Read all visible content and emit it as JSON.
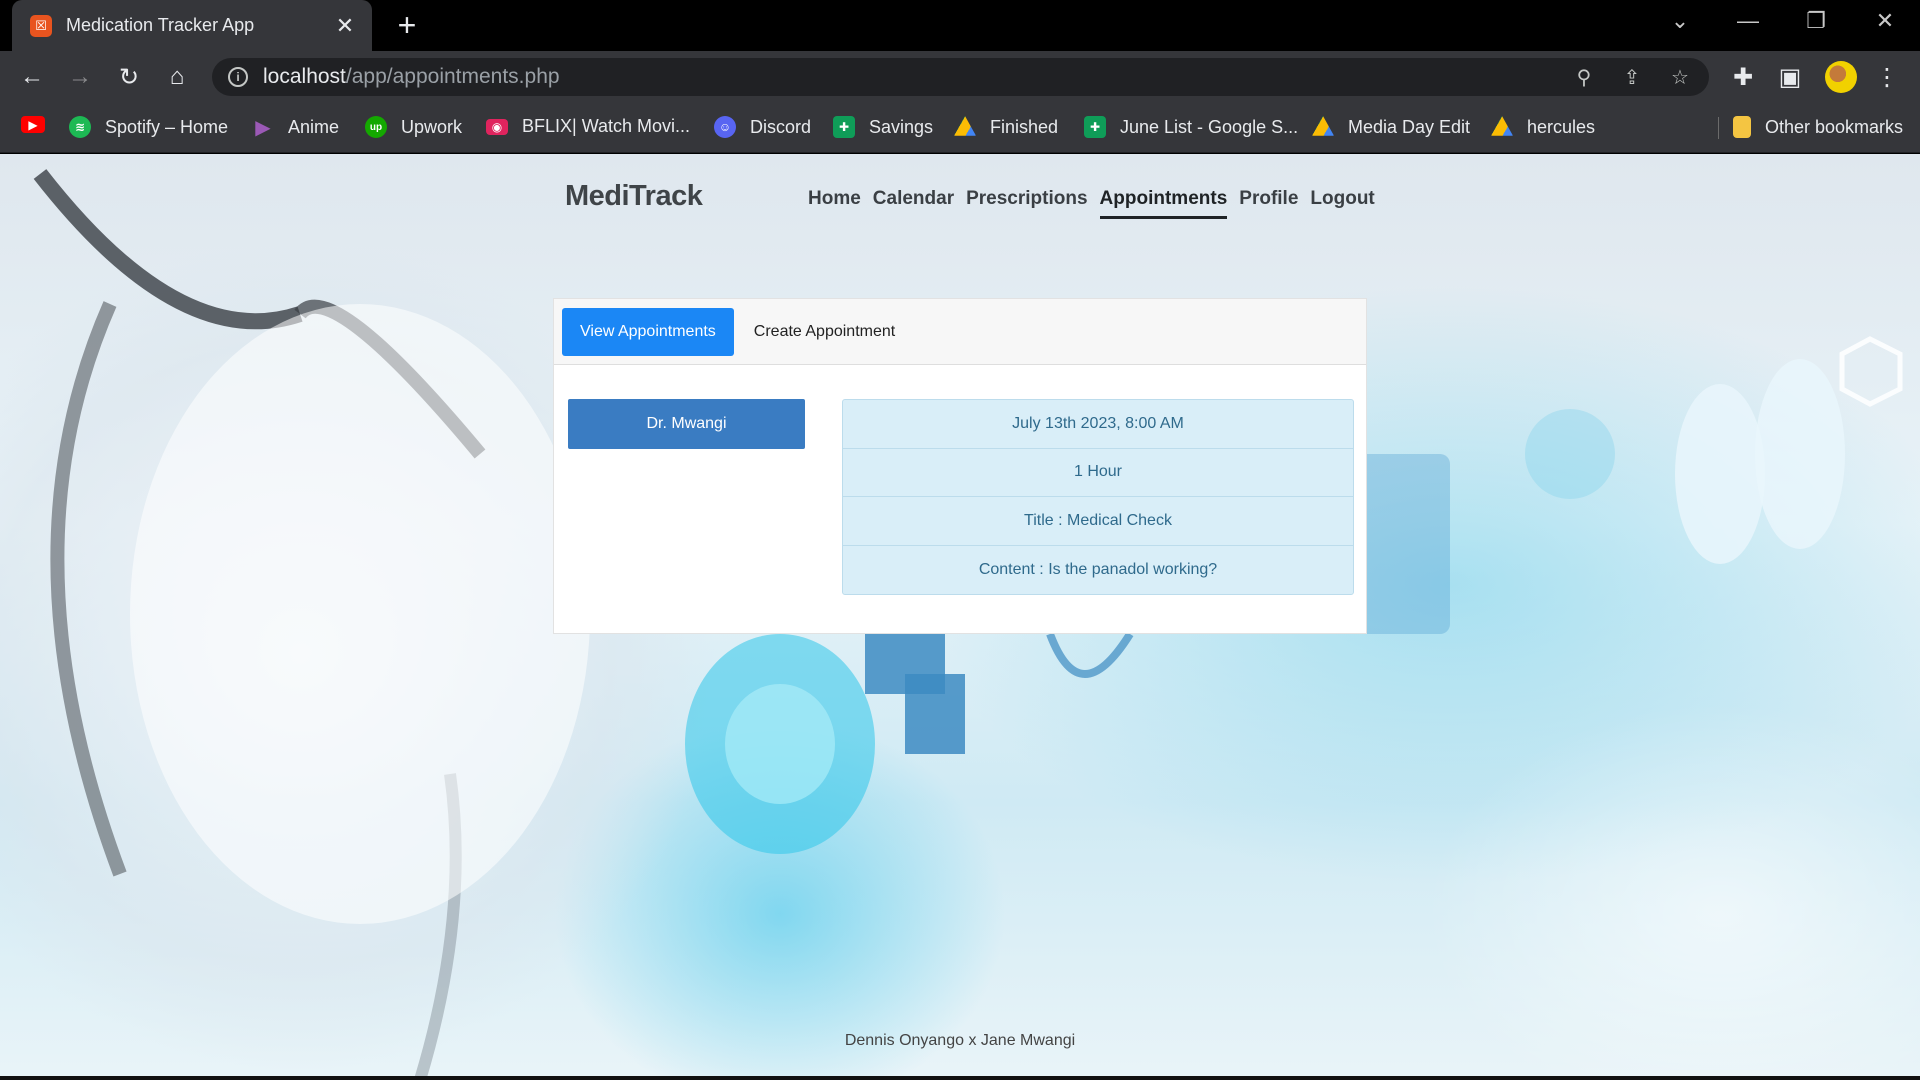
{
  "browser": {
    "tab_title": "Medication Tracker App",
    "tab_close": "✕",
    "new_tab": "+",
    "url_host": "localhost",
    "url_path": "/app/appointments.php",
    "bookmarks": [
      {
        "label": "",
        "icon": "youtube-icon",
        "color": "#ff0000"
      },
      {
        "label": "Spotify – Home",
        "icon": "spotify-icon",
        "color": "#1db954"
      },
      {
        "label": "Anime",
        "icon": "play-icon",
        "color": "#8e44ad"
      },
      {
        "label": "Upwork",
        "icon": "upwork-icon",
        "color": "#14a800"
      },
      {
        "label": "BFLIX| Watch Movi...",
        "icon": "bflix-icon",
        "color": "#e0245e"
      },
      {
        "label": "Discord",
        "icon": "discord-icon",
        "color": "#5865f2"
      },
      {
        "label": "Savings",
        "icon": "sheets-icon",
        "color": "#0f9d58"
      },
      {
        "label": "Finished",
        "icon": "drive-icon",
        "color": "#fbbc04"
      },
      {
        "label": "June List - Google S...",
        "icon": "sheets-icon",
        "color": "#0f9d58"
      },
      {
        "label": "Media Day Edit",
        "icon": "drive-icon",
        "color": "#fbbc04"
      },
      {
        "label": "hercules",
        "icon": "drive-icon",
        "color": "#fbbc04"
      },
      {
        "label": "Other bookmarks",
        "icon": "folder-icon",
        "color": "#f4c542"
      }
    ]
  },
  "site": {
    "brand": "MediTrack",
    "nav": [
      "Home",
      "Calendar",
      "Prescriptions",
      "Appointments",
      "Profile",
      "Logout"
    ],
    "active_nav": "Appointments"
  },
  "appointments": {
    "tabs": [
      "View Appointments",
      "Create Appointment"
    ],
    "active_tab": "View Appointments",
    "doctor": "Dr. Mwangi",
    "details": {
      "datetime": "July 13th 2023, 8:00 AM",
      "duration": "1 Hour",
      "title": "Title : Medical Check",
      "content": "Content : Is the panadol working?"
    }
  },
  "footer": {
    "credits": "Dennis Onyango x Jane Mwangi"
  }
}
